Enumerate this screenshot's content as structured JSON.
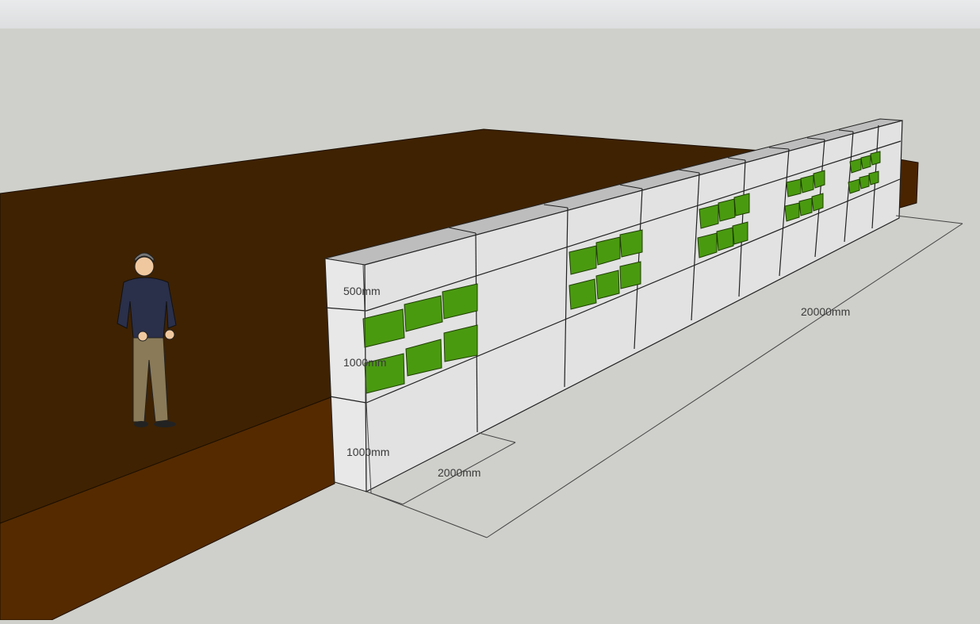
{
  "app": {
    "window_title": "",
    "viewport": {
      "background": "#cfd0cb",
      "ground_dark": "#3f2202",
      "ground_mid": "#552a00",
      "wall_face": "#e2e2e2",
      "wall_top": "#bdbdbd",
      "planter_green": "#4a9a10",
      "planter_dark": "#2f6b06"
    },
    "dimensions": {
      "d500": "500mm",
      "d1000a": "1000mm",
      "d1000b": "1000mm",
      "d2000": "2000mm",
      "d20000": "20000mm"
    },
    "figure": {
      "name": "scale-figure-person"
    }
  }
}
